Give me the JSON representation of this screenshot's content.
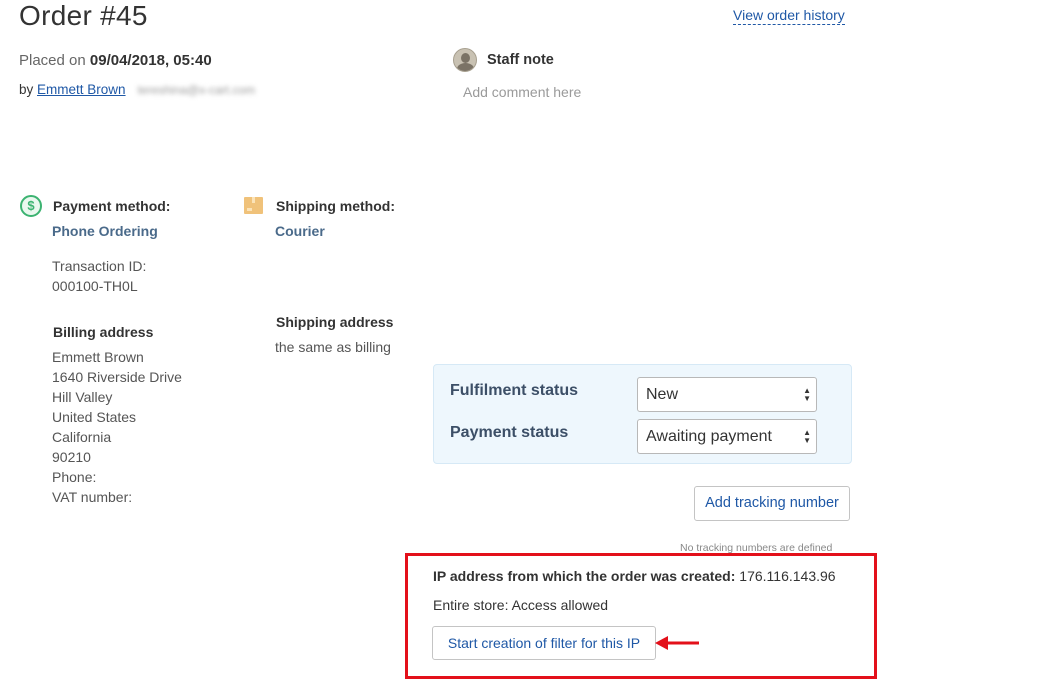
{
  "header": {
    "order_title": "Order #45",
    "history_link": "View order history",
    "placed_prefix": "Placed on",
    "placed_date": "09/04/2018, 05:40",
    "by_prefix": "by",
    "customer_name": "Emmett Brown",
    "customer_email_blurred": "tereshina@x-cart.com"
  },
  "staff_note": {
    "title": "Staff note",
    "placeholder": "Add comment here"
  },
  "payment": {
    "label": "Payment method:",
    "method": "Phone Ordering",
    "transaction_label": "Transaction ID:",
    "transaction_id": "000100-TH0L"
  },
  "shipping": {
    "label": "Shipping method:",
    "method": "Courier",
    "address_title": "Shipping address",
    "address_value": "the same as billing"
  },
  "billing": {
    "title": "Billing address",
    "lines": [
      "Emmett Brown",
      "1640 Riverside Drive",
      "Hill Valley",
      "United States",
      "California",
      "90210",
      "Phone:",
      "VAT number:"
    ]
  },
  "status": {
    "fulfilment_label": "Fulfilment status",
    "fulfilment_value": "New",
    "payment_label": "Payment status",
    "payment_value": "Awaiting payment"
  },
  "tracking": {
    "button": "Add tracking number",
    "note": "No tracking numbers are defined"
  },
  "ip_panel": {
    "ip_label": "IP address from which the order was created:",
    "ip_value": "176.116.143.96",
    "access": "Entire store: Access allowed",
    "filter_button": "Start creation of filter for this IP",
    "highlight_color": "#e3101a"
  }
}
